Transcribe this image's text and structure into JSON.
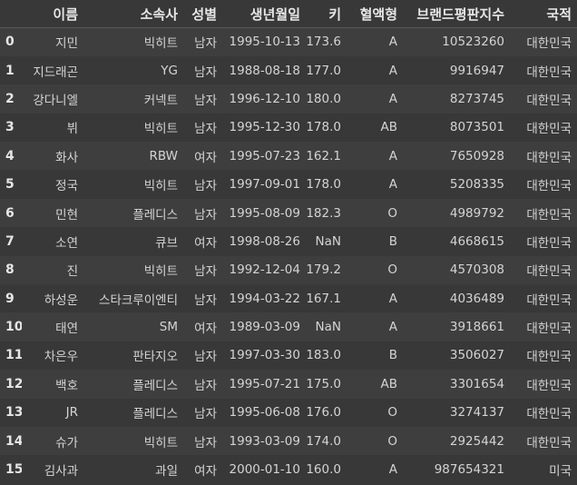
{
  "columns": [
    "이름",
    "소속사",
    "성별",
    "생년월일",
    "키",
    "혈액형",
    "브랜드평판지수",
    "국적"
  ],
  "rows": [
    {
      "index": "0",
      "cells": [
        "지민",
        "빅히트",
        "남자",
        "1995-10-13",
        "173.6",
        "A",
        "10523260",
        "대한민국"
      ]
    },
    {
      "index": "1",
      "cells": [
        "지드래곤",
        "YG",
        "남자",
        "1988-08-18",
        "177.0",
        "A",
        "9916947",
        "대한민국"
      ]
    },
    {
      "index": "2",
      "cells": [
        "강다니엘",
        "커넥트",
        "남자",
        "1996-12-10",
        "180.0",
        "A",
        "8273745",
        "대한민국"
      ]
    },
    {
      "index": "3",
      "cells": [
        "뷔",
        "빅히트",
        "남자",
        "1995-12-30",
        "178.0",
        "AB",
        "8073501",
        "대한민국"
      ]
    },
    {
      "index": "4",
      "cells": [
        "화사",
        "RBW",
        "여자",
        "1995-07-23",
        "162.1",
        "A",
        "7650928",
        "대한민국"
      ]
    },
    {
      "index": "5",
      "cells": [
        "정국",
        "빅히트",
        "남자",
        "1997-09-01",
        "178.0",
        "A",
        "5208335",
        "대한민국"
      ]
    },
    {
      "index": "6",
      "cells": [
        "민현",
        "플레디스",
        "남자",
        "1995-08-09",
        "182.3",
        "O",
        "4989792",
        "대한민국"
      ]
    },
    {
      "index": "7",
      "cells": [
        "소연",
        "큐브",
        "여자",
        "1998-08-26",
        "NaN",
        "B",
        "4668615",
        "대한민국"
      ]
    },
    {
      "index": "8",
      "cells": [
        "진",
        "빅히트",
        "남자",
        "1992-12-04",
        "179.2",
        "O",
        "4570308",
        "대한민국"
      ]
    },
    {
      "index": "9",
      "cells": [
        "하성운",
        "스타크루이엔티",
        "남자",
        "1994-03-22",
        "167.1",
        "A",
        "4036489",
        "대한민국"
      ]
    },
    {
      "index": "10",
      "cells": [
        "태연",
        "SM",
        "여자",
        "1989-03-09",
        "NaN",
        "A",
        "3918661",
        "대한민국"
      ]
    },
    {
      "index": "11",
      "cells": [
        "차은우",
        "판타지오",
        "남자",
        "1997-03-30",
        "183.0",
        "B",
        "3506027",
        "대한민국"
      ]
    },
    {
      "index": "12",
      "cells": [
        "백호",
        "플레디스",
        "남자",
        "1995-07-21",
        "175.0",
        "AB",
        "3301654",
        "대한민국"
      ]
    },
    {
      "index": "13",
      "cells": [
        "JR",
        "플레디스",
        "남자",
        "1995-06-08",
        "176.0",
        "O",
        "3274137",
        "대한민국"
      ]
    },
    {
      "index": "14",
      "cells": [
        "슈가",
        "빅히트",
        "남자",
        "1993-03-09",
        "174.0",
        "O",
        "2925442",
        "대한민국"
      ]
    },
    {
      "index": "15",
      "cells": [
        "김사과",
        "과일",
        "여자",
        "2000-01-10",
        "160.0",
        "A",
        "987654321",
        "미국"
      ]
    }
  ]
}
